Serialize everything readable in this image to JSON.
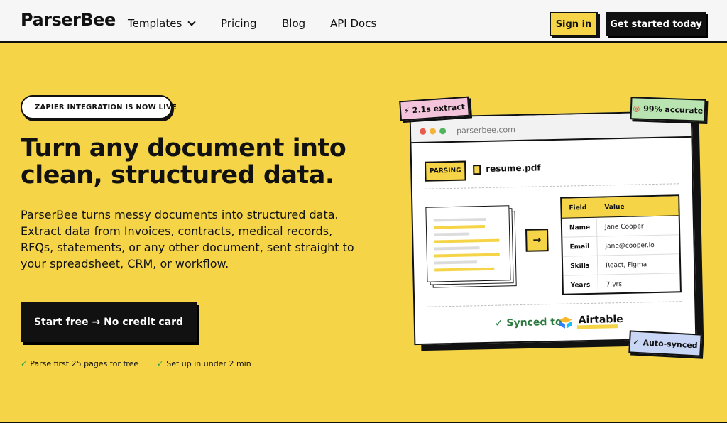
{
  "nav": {
    "logo": "ParserBee",
    "links": [
      "Templates",
      "Pricing",
      "Blog",
      "API Docs"
    ],
    "signin": "Sign in",
    "cta": "Get started today"
  },
  "hero": {
    "badge": "ZAPIER INTEGRATION IS NOW LIVE",
    "headline": "Turn any document into clean, structured data.",
    "description": "ParserBee turns messy documents into structured data. Extract data from Invoices, contracts, medical records, RFQs, statements, or any other document, sent straight to your spreadsheet, CRM, or workflow.",
    "cta": "Start free → No credit card",
    "perks": [
      "Parse first 25 pages for free",
      "Set up in under 2 min"
    ]
  },
  "mock": {
    "url": "parserbee.com",
    "status": "PARSING",
    "filename": "resume.pdf",
    "table": {
      "headers": [
        "Field",
        "Value"
      ],
      "rows": [
        [
          "Name",
          "Jane Cooper"
        ],
        [
          "Email",
          "jane@cooper.io"
        ],
        [
          "Skills",
          "React, Figma"
        ],
        [
          "Years",
          "7 yrs"
        ]
      ]
    },
    "synced_prefix": "✓ Synced to",
    "synced_target": "Airtable",
    "stickers": {
      "extract": "2.1s extract",
      "accuracy": "99% accurate",
      "autosync": "Auto-synced"
    }
  },
  "colors": {
    "brand_yellow": "#f5d547",
    "ink": "#111111",
    "success_green": "#2e9a4a",
    "sticker_pink": "#f3c4dc",
    "sticker_green": "#b9e3b0",
    "sticker_blue": "#c9d6f5"
  }
}
